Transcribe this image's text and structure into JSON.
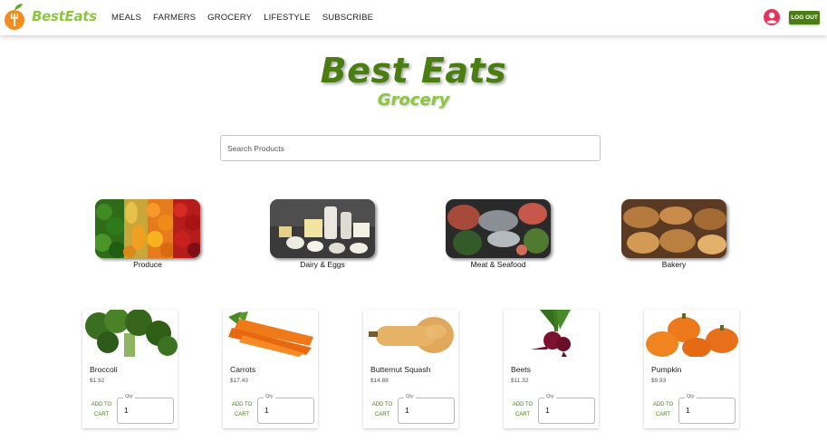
{
  "nav": {
    "brand": "BestEats",
    "links": [
      "MEALS",
      "FARMERS",
      "GROCERY",
      "LIFESTYLE",
      "SUBSCRIBE"
    ],
    "logout_label": "LOG OUT"
  },
  "hero": {
    "title": "Best Eats",
    "subtitle": "Grocery"
  },
  "search": {
    "placeholder": "Search Products",
    "value": ""
  },
  "categories": [
    {
      "label": "Produce"
    },
    {
      "label": "Dairy & Eggs"
    },
    {
      "label": "Meat & Seafood"
    },
    {
      "label": "Bakery"
    }
  ],
  "products": [
    {
      "name": "Broccoli",
      "price": "$1.92",
      "add_label": "ADD TO CART",
      "qty_label": "Qty",
      "qty": "1"
    },
    {
      "name": "Carrots",
      "price": "$17.43",
      "add_label": "ADD TO CART",
      "qty_label": "Qty",
      "qty": "1"
    },
    {
      "name": "Butternut Squash",
      "price": "$14.88",
      "add_label": "ADD TO CART",
      "qty_label": "Qty",
      "qty": "1"
    },
    {
      "name": "Beets",
      "price": "$11.32",
      "add_label": "ADD TO CART",
      "qty_label": "Qty",
      "qty": "1"
    },
    {
      "name": "Pumpkin",
      "price": "$9.93",
      "add_label": "ADD TO CART",
      "qty_label": "Qty",
      "qty": "1"
    }
  ],
  "colors": {
    "brand_dark": "#4a7e13",
    "brand_light": "#8cc63f",
    "logo_orange": "#f28c1c",
    "avatar": "#e8335c"
  }
}
